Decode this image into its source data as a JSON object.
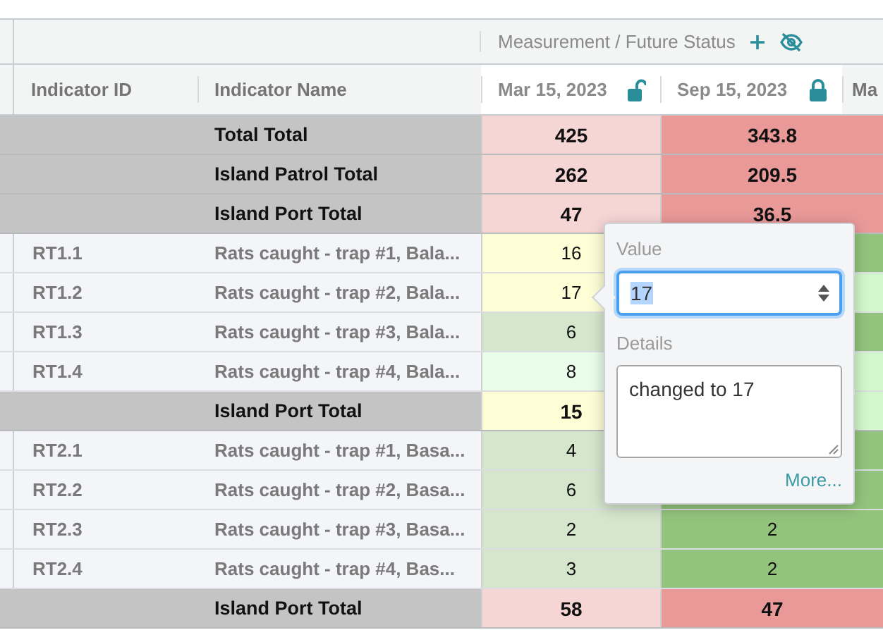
{
  "header": {
    "group_title": "Measurement / Future Status",
    "columns": [
      "Indicator ID",
      "Indicator Name",
      "Mar 15, 2023",
      "Sep 15, 2023",
      "Ma"
    ],
    "locks": [
      {
        "locked": false
      },
      {
        "locked": true
      }
    ]
  },
  "rows": [
    {
      "kind": "total",
      "label": "Total Total",
      "cells": [
        {
          "value": "425",
          "color": "#f6d5d5"
        },
        {
          "value": "343.8",
          "color": "#ea9999"
        }
      ]
    },
    {
      "kind": "total",
      "label": "Island Patrol Total",
      "cells": [
        {
          "value": "262",
          "color": "#f6d5d5"
        },
        {
          "value": "209.5",
          "color": "#ea9999"
        }
      ]
    },
    {
      "kind": "total",
      "label": "Island Port Total",
      "cells": [
        {
          "value": "47",
          "color": "#f6d5d5"
        },
        {
          "value": "36.5",
          "color": "#ea9999"
        }
      ]
    },
    {
      "kind": "item",
      "id": "RT1.1",
      "name": "Rats caught - trap #1, Bala...",
      "cells": [
        {
          "value": "16",
          "color": "#fefed6"
        },
        {
          "color": "#93c47d"
        }
      ]
    },
    {
      "kind": "item",
      "id": "RT1.2",
      "name": "Rats caught - trap #2, Bala...",
      "cells": [
        {
          "value": "17",
          "color": "#fefed6"
        },
        {
          "color": "#d3f7cc"
        }
      ]
    },
    {
      "kind": "item",
      "id": "RT1.3",
      "name": "Rats caught - trap #3, Bala...",
      "cells": [
        {
          "value": "6",
          "color": "#d5e6cc"
        },
        {
          "color": "#93c47d"
        }
      ]
    },
    {
      "kind": "item",
      "id": "RT1.4",
      "name": "Rats caught - trap #4, Bala...",
      "cells": [
        {
          "value": "8",
          "color": "#eafcea"
        },
        {
          "color": "#d3f7cc"
        }
      ]
    },
    {
      "kind": "total",
      "label": "Island Port Total",
      "cells": [
        {
          "value": "15",
          "color": "#fefed6"
        },
        {
          "color": "#d3f7cc"
        }
      ]
    },
    {
      "kind": "item",
      "id": "RT2.1",
      "name": "Rats caught - trap #1, Basa...",
      "cells": [
        {
          "value": "4",
          "color": "#d5e6cc"
        },
        {
          "color": "#93c47d"
        }
      ]
    },
    {
      "kind": "item",
      "id": "RT2.2",
      "name": "Rats caught - trap #2, Basa...",
      "cells": [
        {
          "value": "6",
          "color": "#d5e6cc"
        },
        {
          "color": "#93c47d"
        }
      ]
    },
    {
      "kind": "item",
      "id": "RT2.3",
      "name": "Rats caught - trap #3, Basa...",
      "cells": [
        {
          "value": "2",
          "color": "#d5e6cc"
        },
        {
          "value": "2",
          "color": "#93c47d"
        }
      ]
    },
    {
      "kind": "item",
      "id": "RT2.4",
      "name": "Rats caught - trap #4, Bas...",
      "cells": [
        {
          "value": "3",
          "color": "#d5e6cc"
        },
        {
          "value": "2",
          "color": "#93c47d"
        }
      ]
    },
    {
      "kind": "total",
      "label": "Island Port Total",
      "cells": [
        {
          "value": "58",
          "color": "#f6d5d5"
        },
        {
          "value": "47",
          "color": "#ea9999"
        }
      ]
    }
  ],
  "popover": {
    "value_label": "Value",
    "value": "17",
    "details_label": "Details",
    "details": "changed to 17",
    "more_link": "More..."
  }
}
